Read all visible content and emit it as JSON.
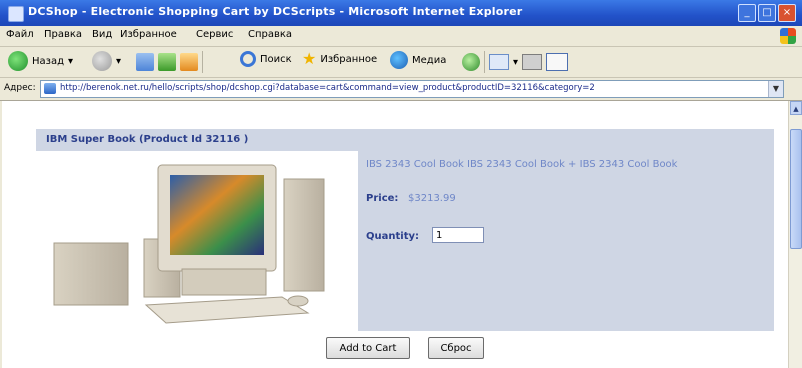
{
  "window": {
    "title": "DCShop - Electronic Shopping Cart by DCScripts - Microsoft Internet Explorer",
    "controls": {
      "minimize": "_",
      "maximize": "□",
      "close": "×"
    }
  },
  "menu": [
    "Файл",
    "Правка",
    "Вид",
    "Избранное",
    "Сервис",
    "Справка"
  ],
  "toolbar": {
    "back_label": "Назад",
    "search_label": "Поиск",
    "favorites_label": "Избранное",
    "media_label": "Медиа"
  },
  "address": {
    "label": "Адрес:",
    "url": "http://berenok.net.ru/hello/scripts/shop/dcshop.cgi?database=cart&command=view_product&productID=32116&category=2"
  },
  "product": {
    "header": "IBM Super Book (Product Id 32116 )",
    "description": "IBS 2343 Cool Book IBS 2343 Cool Book + IBS 2343 Cool Book",
    "price_label": "Price:",
    "price_value": "$3213.99",
    "quantity_label": "Quantity:",
    "quantity_value": "1"
  },
  "buttons": {
    "add_to_cart": "Add to Cart",
    "reset": "Сброс"
  },
  "colors": {
    "panel_bg": "#cfd6e4",
    "heading_text": "#2b3f8c",
    "light_text": "#6f87c8",
    "titlebar": "#2252c9"
  }
}
